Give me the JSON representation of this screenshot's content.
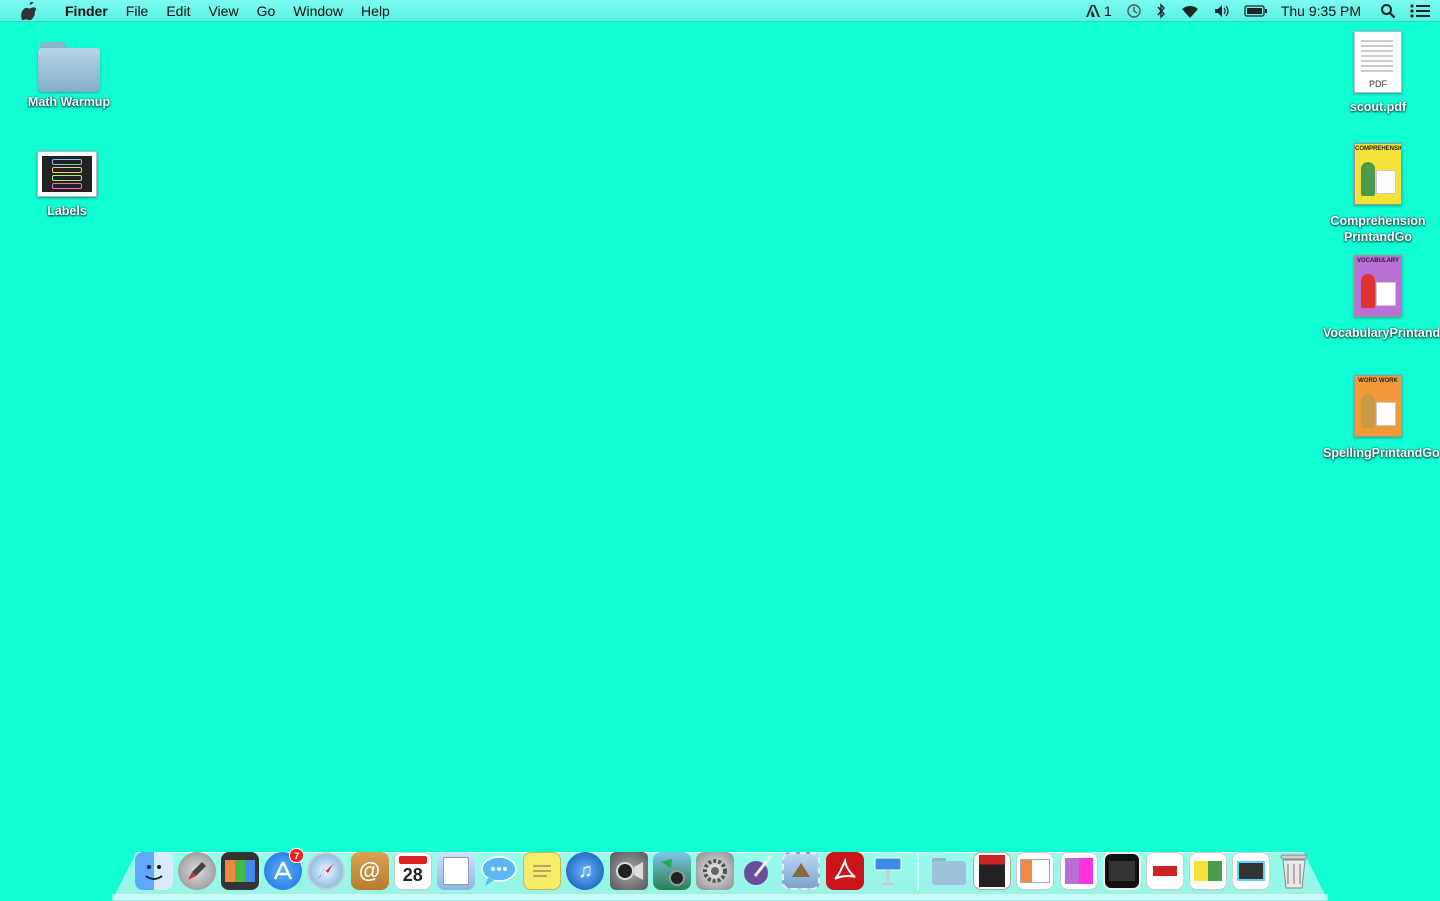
{
  "menubar": {
    "app_name": "Finder",
    "menus": [
      "File",
      "Edit",
      "View",
      "Go",
      "Window",
      "Help"
    ],
    "status": {
      "adobe_count": "1",
      "clock": "Thu 9:35 PM"
    }
  },
  "desktop": {
    "left_icons": [
      {
        "label": "Math Warmup",
        "kind": "folder"
      },
      {
        "label": "Labels",
        "kind": "image"
      }
    ],
    "right_icons": [
      {
        "label": "scout.pdf",
        "kind": "pdf",
        "tag": "PDF"
      },
      {
        "label": "Comprehension PrintandGo",
        "kind": "cover",
        "cover_title": "COMPREHENSION",
        "color": "#f4e13a"
      },
      {
        "label": "VocabularyPrintandGo",
        "kind": "cover",
        "cover_title": "VOCABULARY",
        "color": "#b96fd6"
      },
      {
        "label": "SpellingPrintandGo",
        "kind": "cover",
        "cover_title": "WORD WORK",
        "color": "#f29a3a"
      }
    ]
  },
  "dock": {
    "calendar_day": "28",
    "app_store_badge": "7",
    "apps": [
      {
        "name": "finder"
      },
      {
        "name": "launchpad"
      },
      {
        "name": "photo-booth"
      },
      {
        "name": "app-store"
      },
      {
        "name": "safari"
      },
      {
        "name": "contacts"
      },
      {
        "name": "calendar"
      },
      {
        "name": "preview"
      },
      {
        "name": "messages"
      },
      {
        "name": "stickies"
      },
      {
        "name": "itunes"
      },
      {
        "name": "facetime"
      },
      {
        "name": "iphoto"
      },
      {
        "name": "system-preferences"
      },
      {
        "name": "script-editor"
      },
      {
        "name": "mail-stamp"
      },
      {
        "name": "adobe-reader"
      },
      {
        "name": "keynote"
      }
    ],
    "stacks": [
      {
        "name": "folder-stack"
      },
      {
        "name": "book-thumb"
      },
      {
        "name": "doc-thumb-1"
      },
      {
        "name": "doc-thumb-2"
      },
      {
        "name": "doc-thumb-3"
      },
      {
        "name": "doc-thumb-4"
      },
      {
        "name": "doc-thumb-5"
      },
      {
        "name": "doc-thumb-6"
      }
    ]
  }
}
